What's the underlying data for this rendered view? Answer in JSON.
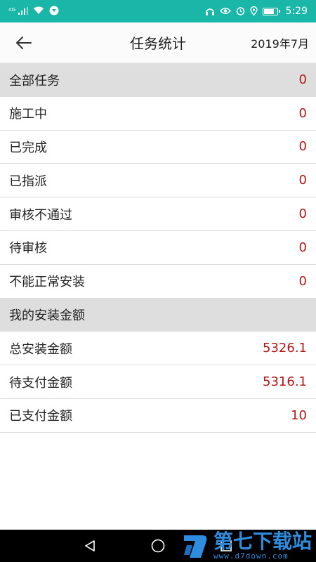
{
  "status_bar": {
    "network": "4G",
    "time": "5:29",
    "battery_level": 0.8
  },
  "app_bar": {
    "title": "任务统计",
    "date": "2019年7月"
  },
  "task_section": {
    "header": {
      "label": "全部任务",
      "value": "0"
    },
    "items": [
      {
        "label": "施工中",
        "value": "0"
      },
      {
        "label": "已完成",
        "value": "0"
      },
      {
        "label": "已指派",
        "value": "0"
      },
      {
        "label": "审核不通过",
        "value": "0"
      },
      {
        "label": "待审核",
        "value": "0"
      },
      {
        "label": "不能正常安装",
        "value": "0"
      }
    ]
  },
  "amount_section": {
    "header": {
      "label": "我的安装金额"
    },
    "items": [
      {
        "label": "总安装金额",
        "value": "5326.1"
      },
      {
        "label": "待支付金额",
        "value": "5316.1"
      },
      {
        "label": "已支付金额",
        "value": "10"
      }
    ]
  },
  "watermark": {
    "title": "第七下载站",
    "url": "www.d7down.com"
  },
  "colors": {
    "status_bar": "#1ab6a8",
    "value_red": "#b41515",
    "section_header_bg": "#dedede"
  }
}
